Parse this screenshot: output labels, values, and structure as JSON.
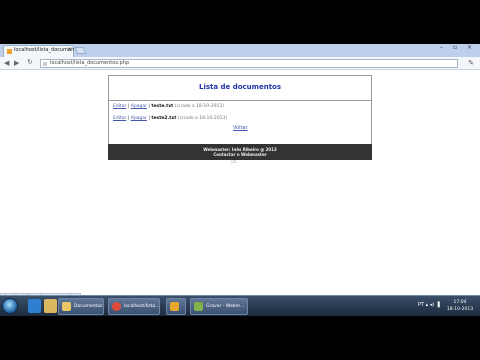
{
  "browser": {
    "tab_title": "localhost/lista_documen",
    "tab_close": "×",
    "url": "localhost/lista_documentos.php",
    "window_controls": "– ▫ ×",
    "back_icon": "◀",
    "forward_icon": "▶",
    "reload_icon": "↻",
    "wrench_icon": "✎"
  },
  "page": {
    "title": "Lista de documentos",
    "documents": [
      {
        "edit": "Editar",
        "delete": "Apagar",
        "separator": "|",
        "name": "teste.txt",
        "meta": "(criado a 18-10-2013)"
      },
      {
        "edit": "Editar",
        "delete": "Apagar",
        "separator": "|",
        "name": "teste2.txt",
        "meta": "(criado a 18-10-2013)"
      }
    ],
    "back_link": "Voltar",
    "footer_line1": "Webmaster: Inês Ribeiro @ 2013",
    "footer_line2": "Contactar o Webmaster"
  },
  "status_bar": "localhost/lista_documentos.php",
  "taskbar": {
    "buttons": [
      {
        "label": "Documentos",
        "color": "#e8c766"
      },
      {
        "label": "localhost/lista...",
        "color": "#e04a3a"
      },
      {
        "label": "",
        "color": "#e8a830"
      },
      {
        "label": "Gravar - Webm...",
        "color": "#7fb24a"
      }
    ],
    "tray": "PT ▴ ◂) ▐",
    "time": "17:04",
    "date": "18-10-2013"
  },
  "colors": {
    "accent_title": "#2233aa",
    "footer_bg": "#333333",
    "link": "#4455aa"
  }
}
